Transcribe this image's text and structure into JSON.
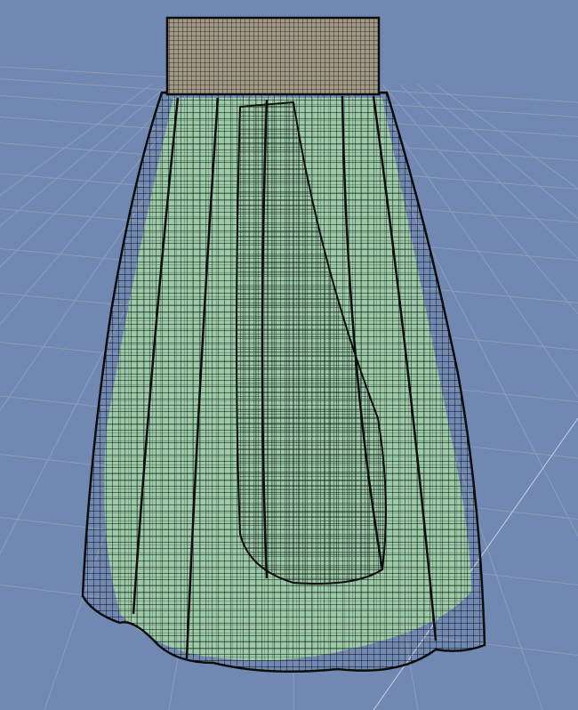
{
  "viewport": {
    "background": "#7189b2",
    "grid_color": "#8e9cb8",
    "mesh_color": "#0a0d0c",
    "surface_color": "#9ccaa8",
    "waistband_color": "#a49a88"
  }
}
